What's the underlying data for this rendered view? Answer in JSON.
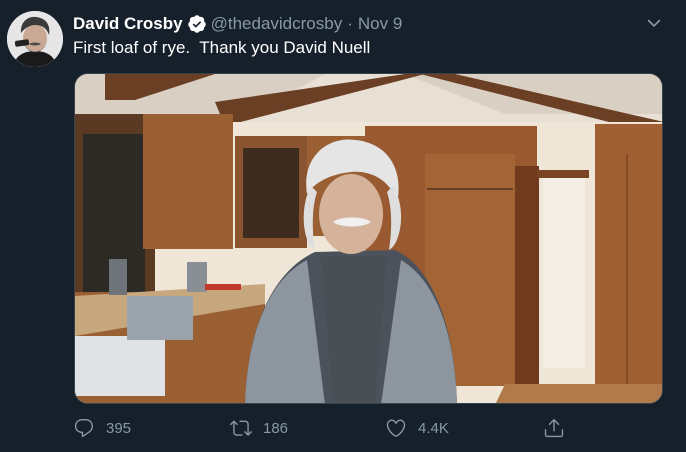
{
  "author": {
    "display_name": "David Crosby",
    "handle": "@thedavidcrosby",
    "separator": "·",
    "date": "Nov 9",
    "verified": true,
    "avatar": "profile-photo"
  },
  "tweet": {
    "text": "First loaf of rye.  Thank you David Nuell"
  },
  "media": {
    "kind": "photo",
    "content": "man-in-kitchen-photo"
  },
  "actions": {
    "reply": {
      "icon": "reply-icon",
      "count": "395"
    },
    "retweet": {
      "icon": "retweet-icon",
      "count": "186"
    },
    "like": {
      "icon": "heart-icon",
      "count": "4.4K"
    },
    "share": {
      "icon": "share-icon"
    }
  },
  "menu": {
    "icon": "chevron-down-icon"
  },
  "colors": {
    "background": "#15202b",
    "primary_text": "#ffffff",
    "secondary_text": "#8899a6",
    "verified": "#ffffff"
  }
}
